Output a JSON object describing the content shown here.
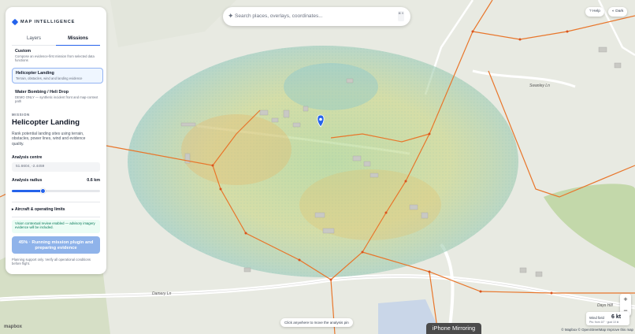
{
  "app": {
    "brand": "MAP INTELLIGENCE"
  },
  "tabs": [
    {
      "label": "Layers"
    },
    {
      "label": "Missions"
    }
  ],
  "missions": [
    {
      "title": "Custom",
      "desc": "Compose an evidence-first mission from selected data functions"
    },
    {
      "title": "Helicopter Landing",
      "desc": "Terrain, obstacles, wind and landing evidence"
    },
    {
      "title": "Water Bombing / Heli Drop",
      "desc": "DEMO ONLY — synthetic incident front and map-context path"
    }
  ],
  "mission": {
    "section_label": "MISSION",
    "title": "Helicopter Landing",
    "description": "Rank potential landing sites using terrain, obstacles, power lines, wind and evidence quality.",
    "centre_label": "Analysis centre",
    "centre_value": "51.6604, -2.4459",
    "radius_label": "Analysis radius",
    "radius_value": "0.6 km",
    "radius_fraction": 0.35,
    "aircraft_label": "▸ Aircraft & operating limits",
    "vision_note": "Vision contextual review enabled — advisory imagery evidence will be included.",
    "run_label": "45% · Running mission plugin and preparing evidence",
    "progress_percent": 45,
    "support_note": "Planning support only. Verify all operational conditions before flight."
  },
  "search": {
    "placeholder": "Search places, overlays, coordinates...",
    "shortcut": "⌘ K"
  },
  "top_buttons": {
    "help": "Help",
    "theme": "Dark"
  },
  "map": {
    "roads": {
      "damery_ln": "Damery Ln",
      "swanley_ln": "Swanley Ln"
    },
    "hint": "Click anywhere to move the analysis pin",
    "wind_label": "Wind field",
    "wind_value": "6 kt",
    "wind_sub": "Pts: from 10° · gust 10 kt",
    "zoom_in": "+",
    "zoom_out": "−",
    "attribution": "© Mapbox © OpenStreetMap Improve this map",
    "logo": "mapbox",
    "place_label": "Days Hill"
  },
  "overlay": {
    "mirroring": "iPhone Mirroring"
  },
  "colors": {
    "accent": "#2563eb",
    "powerline": "#e8762b",
    "pin": "#2563eb"
  }
}
